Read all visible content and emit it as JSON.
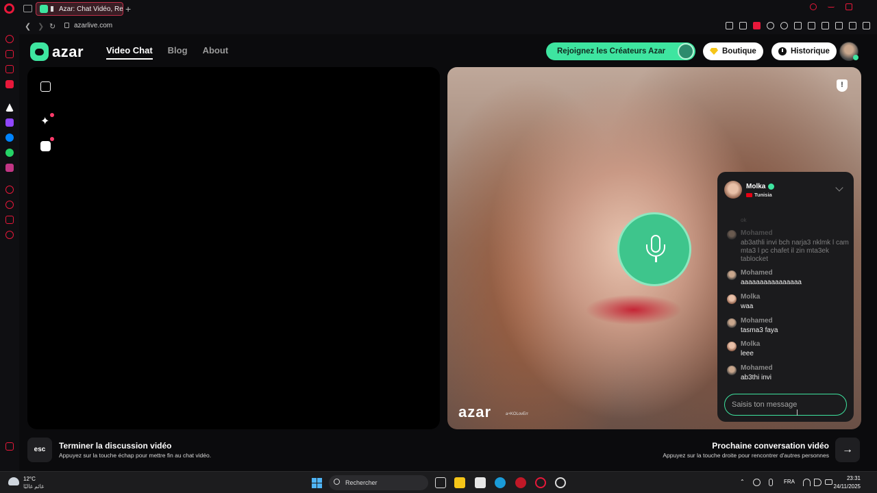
{
  "browser": {
    "tab_title": "Azar: Chat Vidéo, Ren",
    "new_tab": "+",
    "url": "azarlive.com"
  },
  "site": {
    "logo_text": "azar",
    "nav": [
      "Video Chat",
      "Blog",
      "About"
    ],
    "creators_button": "Rejoignez les Créateurs Azar",
    "shop_button": "Boutique",
    "history_button": "Historique"
  },
  "partner": {
    "name": "Molka",
    "country": "Tunisia",
    "watermark": "azar",
    "watermark_handle": "a+KOLovErr"
  },
  "chat": {
    "top_partial": "ok",
    "messages": [
      {
        "sender": "Mohamed",
        "text": "ab3athli invi bch narja3 nklmk l cam mta3 l pc chafet il zin mta3ek tablocket",
        "faded": true
      },
      {
        "sender": "Mohamed",
        "text": "aaaaaaaaaaaaaaaa",
        "faded": false
      },
      {
        "sender": "Molka",
        "text": "waa",
        "faded": false
      },
      {
        "sender": "Mohamed",
        "text": "tasma3 faya",
        "faded": false
      },
      {
        "sender": "Molka",
        "text": "leee",
        "faded": false
      },
      {
        "sender": "Mohamed",
        "text": "ab3thi invi",
        "faded": false
      }
    ],
    "input_placeholder": "Saisis ton message"
  },
  "controls": {
    "esc_key": "esc",
    "end_title": "Terminer la discussion vidéo",
    "end_subtitle": "Appuyez sur la touche échap pour mettre fin au chat vidéo.",
    "next_title": "Prochaine conversation vidéo",
    "next_subtitle": "Appuyez sur la touche droite pour rencontrer d'autres personnes",
    "next_arrow": "→"
  },
  "taskbar": {
    "temperature": "12°C",
    "weather_desc": "غائم غالبًا",
    "search_label": "Rechercher",
    "language": "FRA",
    "time": "23:31",
    "date": "24/11/2025"
  },
  "colors": {
    "accent": "#3ee5a0",
    "browser_accent": "#e8183a"
  }
}
